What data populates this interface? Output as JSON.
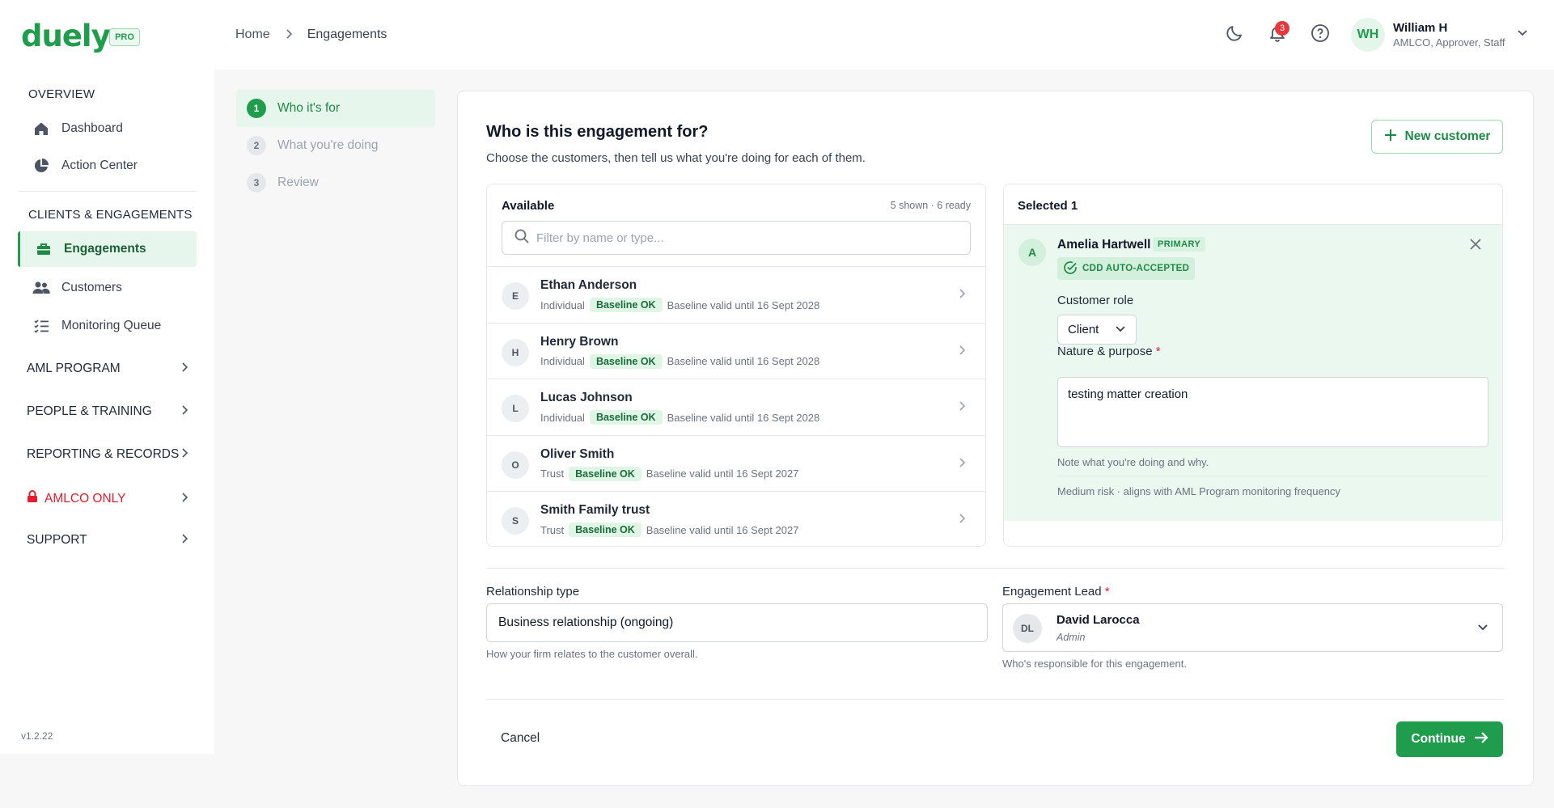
{
  "brand": {
    "logo": "duely",
    "badge": "PRO",
    "accent": "#1f9d4c"
  },
  "breadcrumb": {
    "home": "Home",
    "current": "Engagements"
  },
  "header": {
    "notifications_count": "3",
    "user": {
      "initials": "WH",
      "name": "William H",
      "role": "AMLCO, Approver, Staff"
    },
    "icons": [
      "moon-icon",
      "bell-icon",
      "help-icon",
      "chevron-down-icon"
    ]
  },
  "sidebar": {
    "overview_title": "OVERVIEW",
    "dashboard": "Dashboard",
    "action_center": "Action Center",
    "clients_title": "CLIENTS & ENGAGEMENTS",
    "engagements": "Engagements",
    "customers": "Customers",
    "monitoring_queue": "Monitoring Queue",
    "groups": [
      "AML PROGRAM",
      "PEOPLE & TRAINING",
      "REPORTING & RECORDS",
      "AMLCO ONLY",
      "SUPPORT"
    ],
    "version": "v1.2.22"
  },
  "steps": [
    {
      "num": "1",
      "label": "Who it's for"
    },
    {
      "num": "2",
      "label": "What you're doing"
    },
    {
      "num": "3",
      "label": "Review"
    }
  ],
  "main": {
    "title": "Who is this engagement for?",
    "subtitle": "Choose the customers, then tell us what you're doing for each of them.",
    "new_customer": "New customer"
  },
  "available": {
    "title": "Available",
    "count": "5 shown · 6 ready",
    "search_placeholder": "Filter by name or type...",
    "items": [
      {
        "initial": "E",
        "name": "Ethan Anderson",
        "type": "Individual",
        "badge": "Baseline OK",
        "validity": "Baseline valid until 16 Sept 2028"
      },
      {
        "initial": "H",
        "name": "Henry Brown",
        "type": "Individual",
        "badge": "Baseline OK",
        "validity": "Baseline valid until 16 Sept 2028"
      },
      {
        "initial": "L",
        "name": "Lucas Johnson",
        "type": "Individual",
        "badge": "Baseline OK",
        "validity": "Baseline valid until 16 Sept 2028"
      },
      {
        "initial": "O",
        "name": "Oliver Smith",
        "type": "Trust",
        "badge": "Baseline OK",
        "validity": "Baseline valid until 16 Sept 2027"
      },
      {
        "initial": "S",
        "name": "Smith Family trust",
        "type": "Trust",
        "badge": "Baseline OK",
        "validity": "Baseline valid until 16 Sept 2027"
      }
    ]
  },
  "selected": {
    "title": "Selected 1",
    "initial": "A",
    "name": "Amelia Hartwell",
    "primary": "PRIMARY",
    "cdd": "CDD AUTO-ACCEPTED",
    "role_label": "Customer role",
    "role_value": "Client",
    "purpose_label": "Nature & purpose",
    "required_mark": "*",
    "purpose_value": "testing matter creation",
    "purpose_hint": "Note what you're doing and why.",
    "risk_note": "Medium risk · aligns with AML Program monitoring frequency"
  },
  "relationship": {
    "label": "Relationship type",
    "value": "Business relationship (ongoing)",
    "hint": "How your firm relates to the customer overall."
  },
  "lead": {
    "label": "Engagement Lead",
    "required_mark": "*",
    "initials": "DL",
    "name": "David Larocca",
    "role": "Admin",
    "hint": "Who's responsible for this engagement."
  },
  "footer": {
    "cancel": "Cancel",
    "continue": "Continue"
  }
}
